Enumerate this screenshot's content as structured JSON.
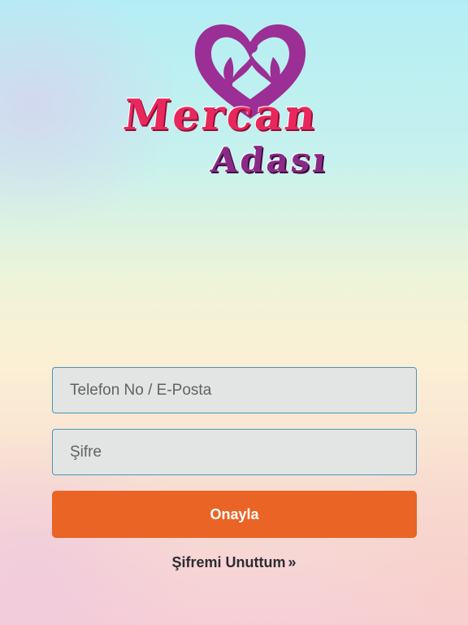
{
  "logo": {
    "line1": "Mercan",
    "line2": "Adası",
    "heart_color": "#9b2f95",
    "line1_color": "#e8285c",
    "line2_color": "#8a2a86"
  },
  "form": {
    "phone_placeholder": "Telefon No / E-Posta",
    "phone_value": "",
    "password_placeholder": "Şifre",
    "password_value": "",
    "submit_label": "Onayla",
    "submit_color": "#ea6425"
  },
  "forgot": {
    "label": "Şifremi Unuttum",
    "icon": "double-chevron-right-icon",
    "glyph": "»"
  }
}
